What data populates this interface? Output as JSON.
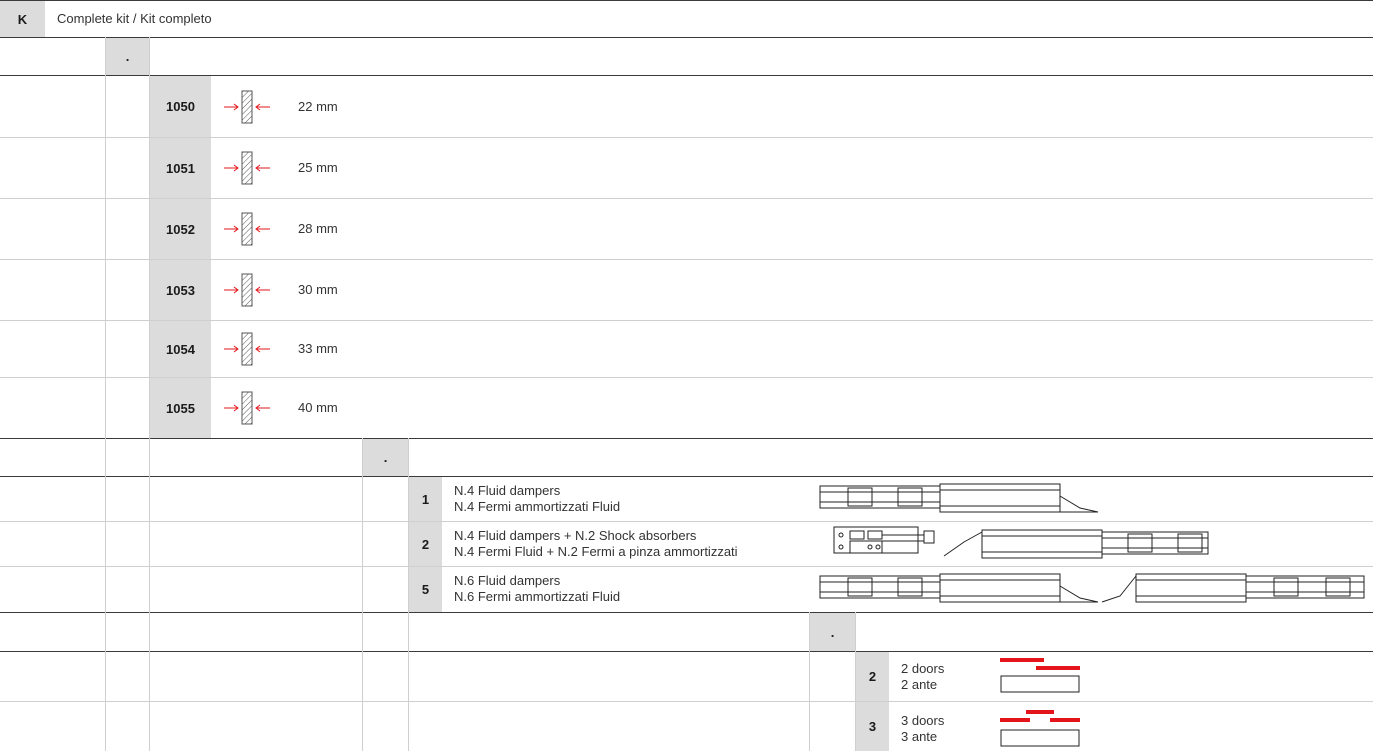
{
  "header": {
    "letter": "K",
    "title": "Complete kit / Kit completo"
  },
  "dot": ".",
  "thickness_rows": [
    {
      "code": "1050",
      "value": "22 mm"
    },
    {
      "code": "1051",
      "value": "25 mm"
    },
    {
      "code": "1052",
      "value": "28 mm"
    },
    {
      "code": "1053",
      "value": "30 mm"
    },
    {
      "code": "1054",
      "value": "33 mm"
    },
    {
      "code": "1055",
      "value": "40 mm"
    }
  ],
  "damper_rows": [
    {
      "code": "1",
      "en": "N.4 Fluid dampers",
      "it": "N.4 Fermi ammortizzati Fluid"
    },
    {
      "code": "2",
      "en": "N.4 Fluid dampers + N.2 Shock absorbers",
      "it": "N.4 Fermi Fluid + N.2 Fermi a pinza ammortizzati"
    },
    {
      "code": "5",
      "en": "N.6 Fluid dampers",
      "it": "N.6 Fermi ammortizzati Fluid"
    }
  ],
  "door_rows": [
    {
      "code": "2",
      "en": "2 doors",
      "it": "2 ante"
    },
    {
      "code": "3",
      "en": "3 doors",
      "it": "3 ante"
    }
  ],
  "colors": {
    "accent": "#e3151b",
    "code_bg": "#dcdcdc",
    "rule": "#3a3a3a"
  }
}
